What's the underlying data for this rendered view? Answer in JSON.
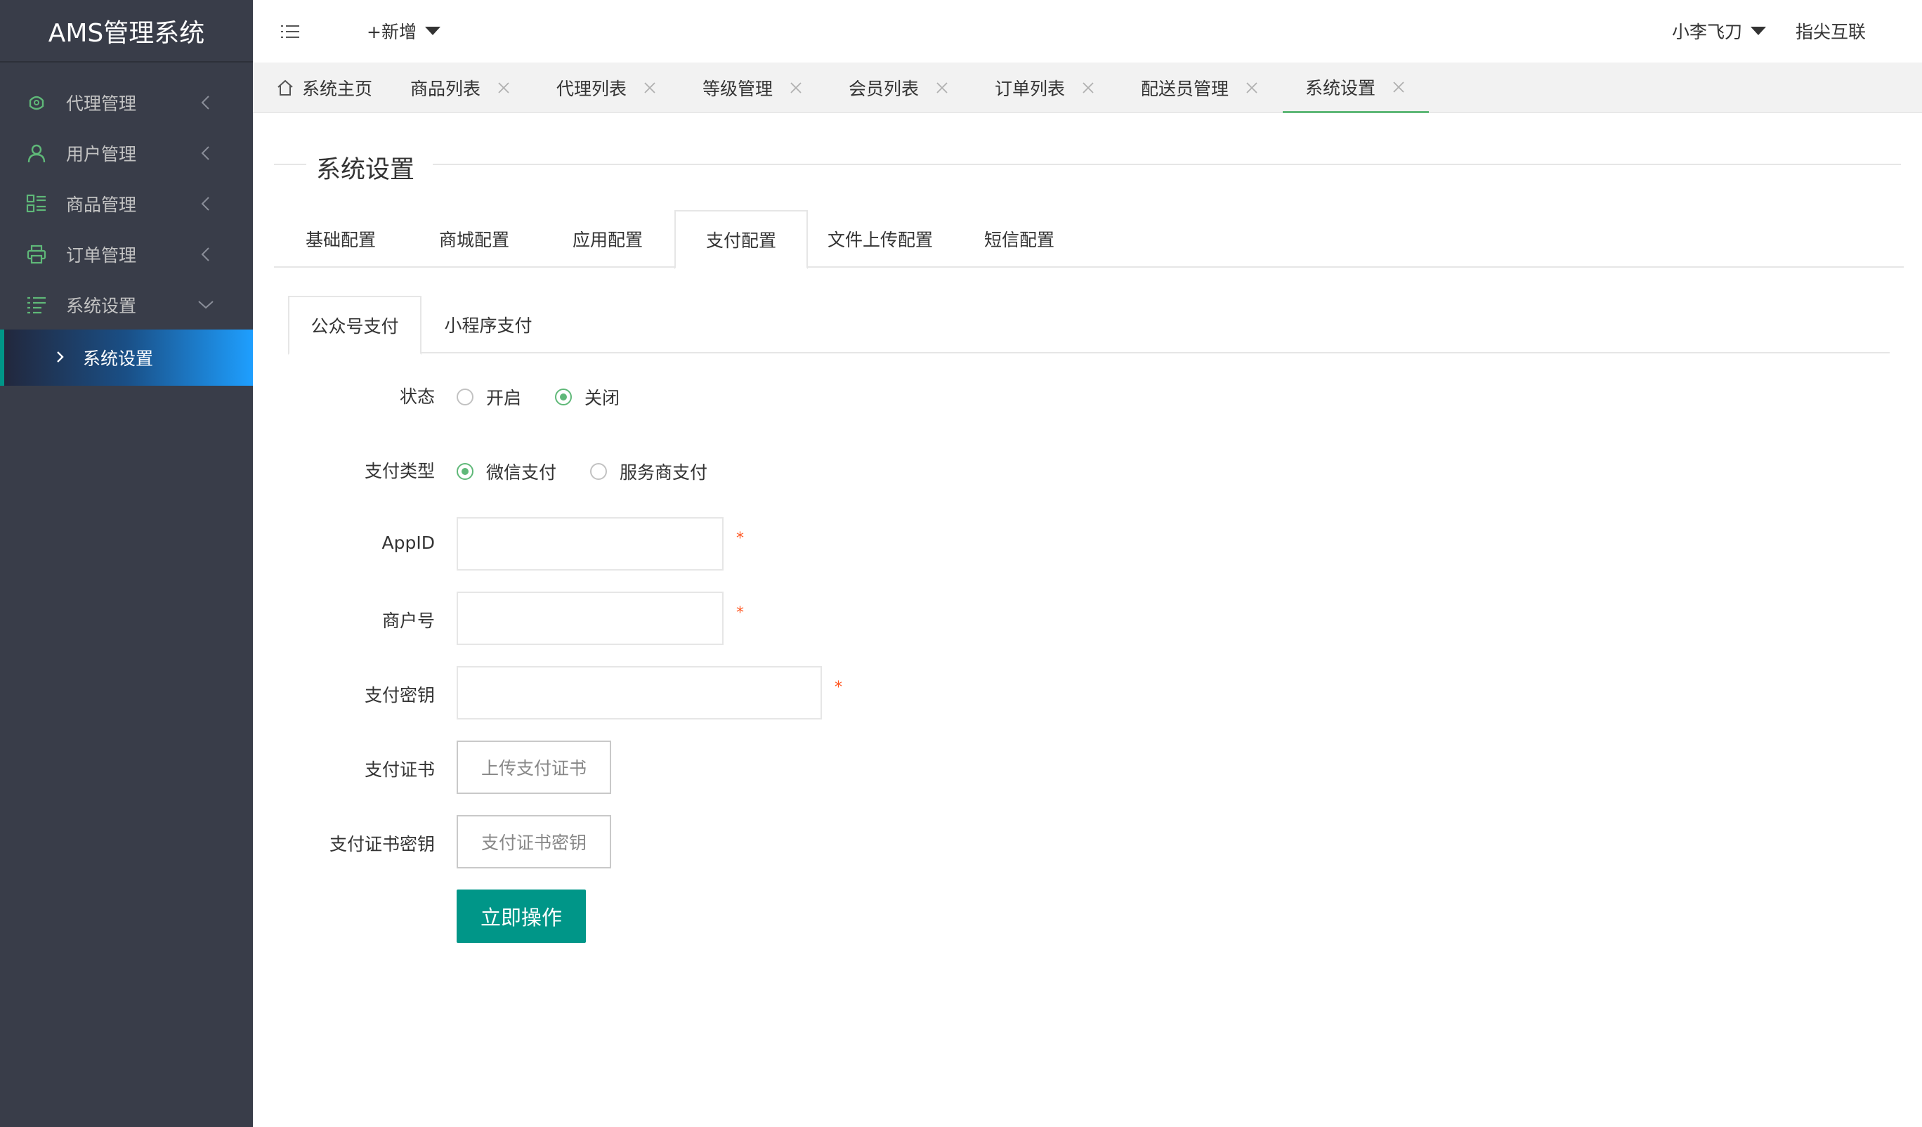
{
  "app": {
    "title": "AMS管理系统"
  },
  "sidebar": {
    "items": [
      {
        "label": "代理管理",
        "icon": "agent-icon"
      },
      {
        "label": "用户管理",
        "icon": "user-icon"
      },
      {
        "label": "商品管理",
        "icon": "goods-icon"
      },
      {
        "label": "订单管理",
        "icon": "printer-icon"
      },
      {
        "label": "系统设置",
        "icon": "settings-list-icon"
      }
    ],
    "active_sub": "系统设置"
  },
  "header": {
    "new_label": "+新增",
    "user": "小李飞刀",
    "brand": "指尖互联"
  },
  "tabs": [
    {
      "label": "系统主页"
    },
    {
      "label": "商品列表"
    },
    {
      "label": "代理列表"
    },
    {
      "label": "等级管理"
    },
    {
      "label": "会员列表"
    },
    {
      "label": "订单列表"
    },
    {
      "label": "配送员管理"
    },
    {
      "label": "系统设置"
    }
  ],
  "main": {
    "section_title": "系统设置",
    "config_tabs": [
      "基础配置",
      "商城配置",
      "应用配置",
      "支付配置",
      "文件上传配置",
      "短信配置"
    ],
    "config_active": "支付配置",
    "pay_tabs": [
      "公众号支付",
      "小程序支付"
    ],
    "pay_active": "公众号支付",
    "form": {
      "status": {
        "label": "状态",
        "options": [
          "开启",
          "关闭"
        ],
        "selected": "关闭"
      },
      "pay_type": {
        "label": "支付类型",
        "options": [
          "微信支付",
          "服务商支付"
        ],
        "selected": "微信支付"
      },
      "appid": {
        "label": "AppID",
        "value": "",
        "required": "*"
      },
      "merchant": {
        "label": "商户号",
        "value": "",
        "required": "*"
      },
      "secret": {
        "label": "支付密钥",
        "value": "",
        "required": "*"
      },
      "cert": {
        "label": "支付证书",
        "button": "上传支付证书"
      },
      "cert_key": {
        "label": "支付证书密钥",
        "button": "支付证书密钥"
      },
      "submit": "立即操作"
    }
  },
  "colors": {
    "sidebar_bg": "#393d49",
    "accent_green": "#009688",
    "radio_green": "#5fb878",
    "required_red": "#ff5722"
  }
}
